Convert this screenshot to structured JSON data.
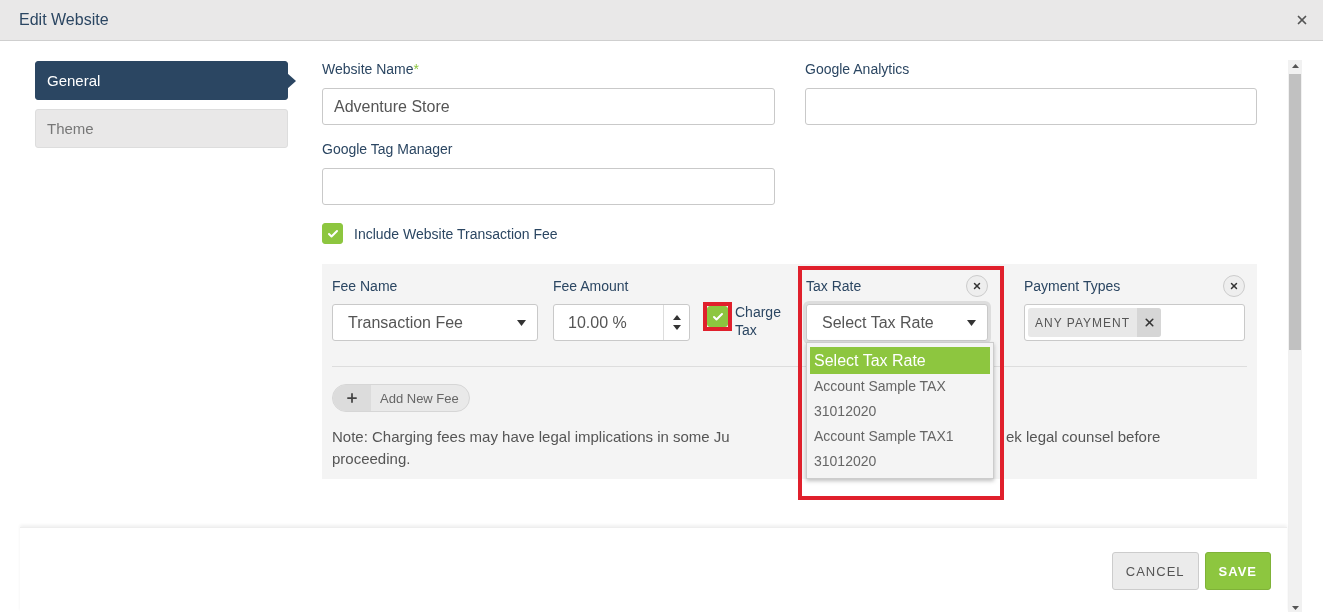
{
  "window": {
    "title": "Edit Website"
  },
  "sidebar": {
    "items": [
      {
        "label": "General",
        "selected": true
      },
      {
        "label": "Theme",
        "selected": false
      }
    ]
  },
  "form": {
    "website_name": {
      "label": "Website Name",
      "required_mark": "*",
      "value": "Adventure Store"
    },
    "google_analytics": {
      "label": "Google Analytics"
    },
    "google_tag_manager": {
      "label": "Google Tag Manager"
    },
    "include_fee": {
      "label": "Include Website Transaction Fee",
      "checked": true
    }
  },
  "fee": {
    "fee_name": {
      "label": "Fee Name",
      "value": "Transaction Fee"
    },
    "fee_amount": {
      "label": "Fee Amount",
      "value": "10.00 %"
    },
    "charge_tax": {
      "label": "Charge Tax",
      "checked": true,
      "highlighted": true
    },
    "tax_rate": {
      "label": "Tax Rate",
      "value": "Select Tax Rate",
      "expanded": true,
      "highlighted": true,
      "options": [
        {
          "label": "Select Tax Rate",
          "selected": true
        },
        {
          "label": "Account Sample TAX 31012020",
          "selected": false
        },
        {
          "label": "Account Sample TAX1 31012020",
          "selected": false
        }
      ]
    },
    "payment_types": {
      "label": "Payment Types",
      "tags": [
        {
          "label": "ANY PAYMENT"
        }
      ]
    },
    "add_fee_button": {
      "label": "Add New Fee"
    },
    "note": {
      "line_1_left": "Note: Charging fees may have legal implications in some Ju",
      "line_1_right": "ek legal counsel before",
      "line_2": "proceeding."
    }
  },
  "buttons": [
    {
      "label": "CANCEL",
      "kind": "secondary"
    },
    {
      "label": "SAVE",
      "kind": "primary"
    }
  ]
}
